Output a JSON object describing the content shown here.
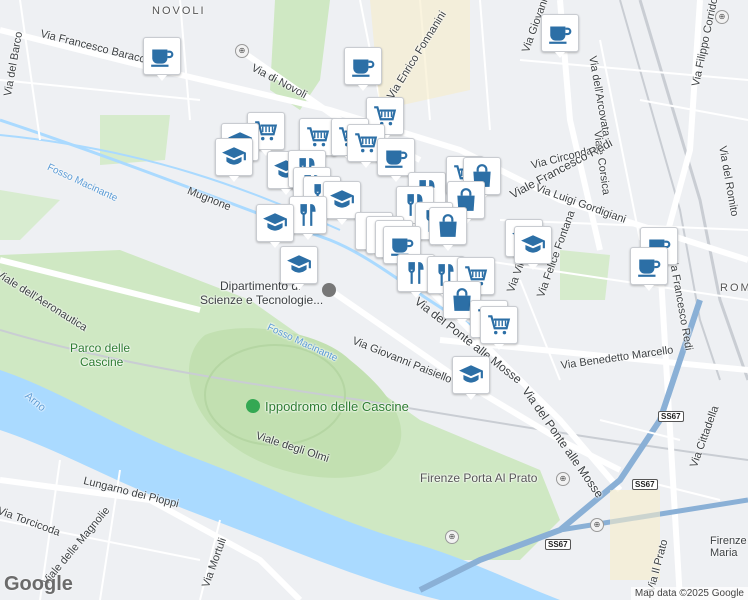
{
  "map": {
    "labels": {
      "novoli": "NOVOLI",
      "via_francesco_baracca": "Via Francesco Baracca",
      "via_del_barco": "Via del Barco",
      "via_di_novoli": "Via di Novoli",
      "via_enrico_fonnanini": "Via Enrico Fonnanini",
      "via_giovanni": "Via Giovanni",
      "via_filippo_corridoni": "Via Filippo Corridoni",
      "via_dell_arcovata": "Via dell'Arcovata",
      "viale_corsica": "Viale Corsica",
      "via_circondaria": "Via Circondaria",
      "via_luigi_gordigiani": "Via Luigi Gordigiani",
      "viale_francesco_redi": "Viale Francesco Redi",
      "via_francesco_redi": "Via Francesco Redi",
      "via_del_romito": "Via del Romito",
      "fosso_macinante_1": "Fosso Macinante",
      "fosso_macinante_2": "Fosso Macinante",
      "mugnone": "Mugnone",
      "dipartimento_line1": "Dipartimento di",
      "dipartimento_line2": "Scienze e Tecnologie...",
      "viale_dell_aeronautica": "Viale dell'Aeronautica",
      "parco_line1": "Parco delle",
      "parco_line2": "Cascine",
      "via_giovanni_paisiello": "Via Giovanni Paisiello",
      "via_del_ponte_alle_mosse_1": "Via del Ponte alle Mosse",
      "via_del_ponte_alle_mosse_2": "Via del Ponte alle Mosse",
      "via_benedetto_marcello": "Via Benedetto Marcello",
      "via_felice_fontana": "Via Felice Fontana",
      "via_vincenzo": "Via Vince",
      "arno": "Arno",
      "ippodromo": "Ippodromo delle Cascine",
      "viale_degli_olmi": "Viale degli Olmi",
      "lungarno_dei_pioppi": "Lungarno dei Pioppi",
      "via_torcicoda": "Via Torcicoda",
      "viale_delle_magnolie": "Viale delle Magnolie",
      "via_mortuli": "Via Mortuli",
      "firenze_porta_al_prato": "Firenze Porta Al Prato",
      "via_cittadella": "Via Cittadella",
      "via_il_prato": "Via Il Prato",
      "firenze_maria": "Firenze Maria",
      "romito": "ROMI",
      "ss67_a": "SS67",
      "ss67_b": "SS67",
      "ss67_c": "SS67"
    },
    "google_logo": "Google",
    "attribution": "Map data ©2025 Google",
    "pin_types": {
      "cafe": "coffee-cup-icon",
      "shop": "shopping-cart-icon",
      "food": "fork-knife-icon",
      "school": "graduation-cap-icon",
      "bag": "shopping-bag-icon"
    },
    "colors": {
      "pin_icon": "#2c6fa6",
      "road_major": "#ffffff",
      "park": "#cfe8c3",
      "water": "#aadaff",
      "highway": "#8ab0d6"
    }
  }
}
